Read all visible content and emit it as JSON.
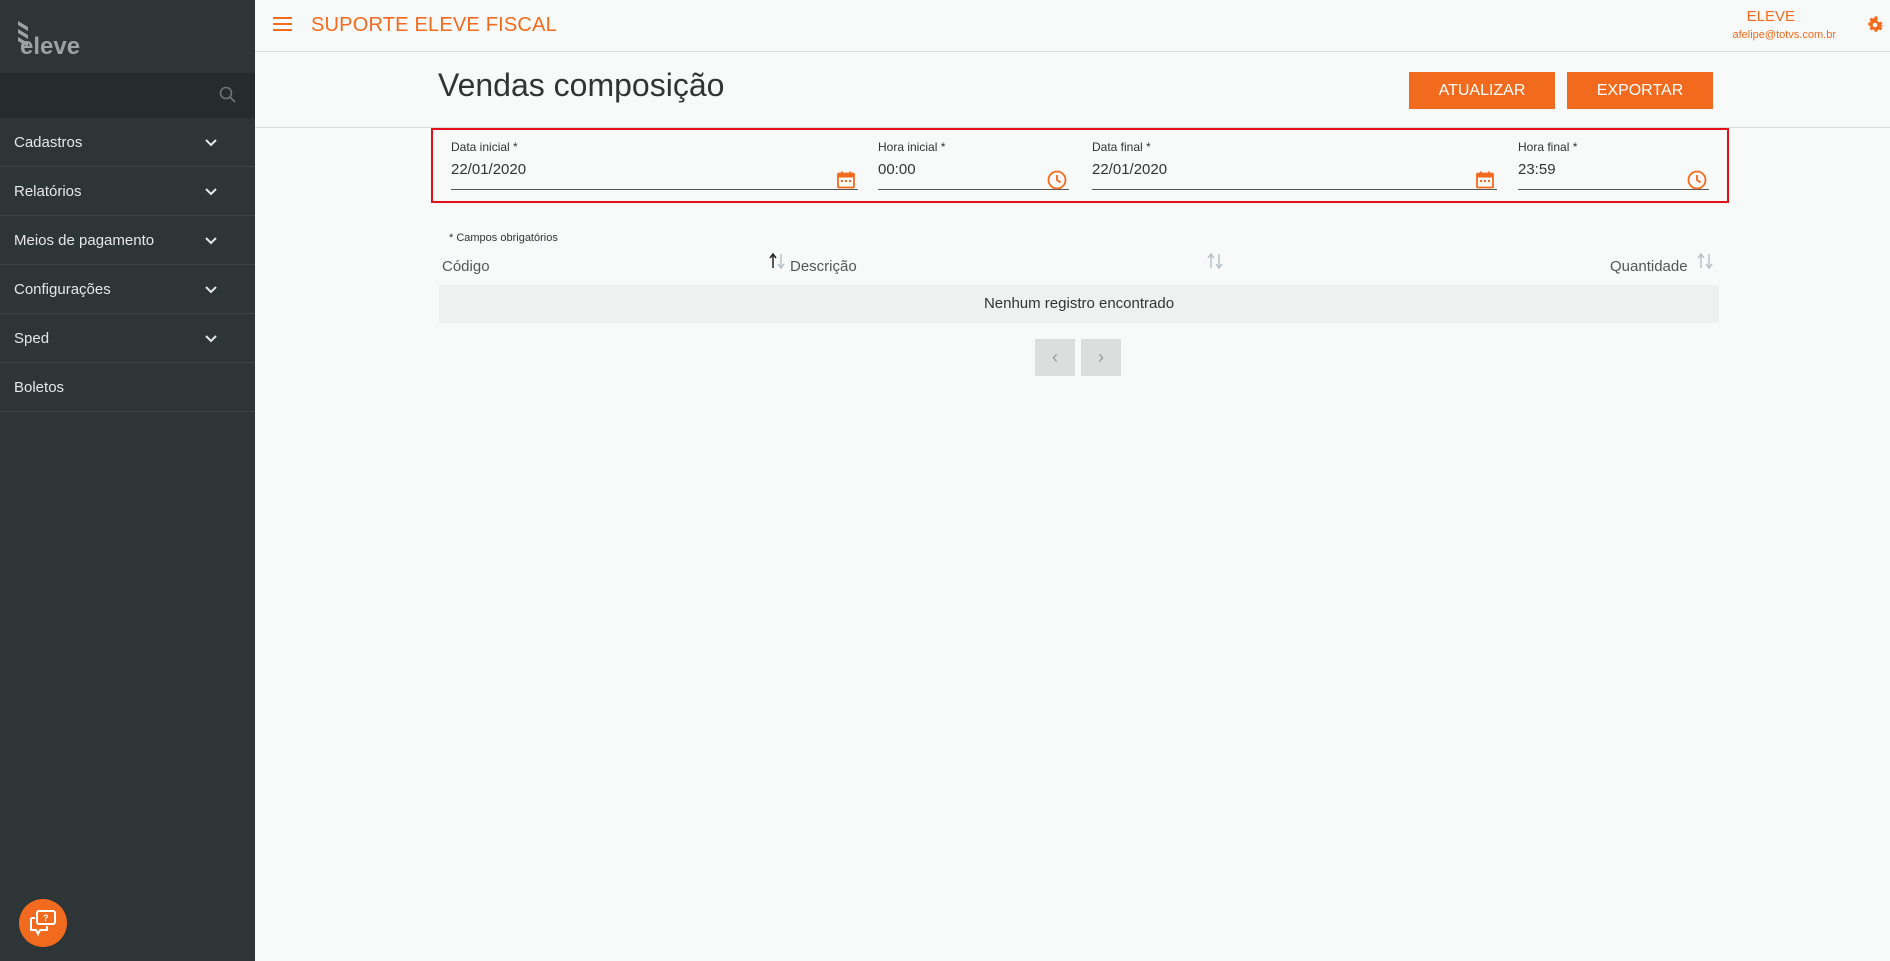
{
  "sidebar": {
    "logo_text": "eleve",
    "items": [
      {
        "label": "Cadastros",
        "expandable": true
      },
      {
        "label": "Relatórios",
        "expandable": true
      },
      {
        "label": "Meios de pagamento",
        "expandable": true
      },
      {
        "label": "Configurações",
        "expandable": true
      },
      {
        "label": "Sped",
        "expandable": true
      },
      {
        "label": "Boletos",
        "expandable": false
      }
    ]
  },
  "header": {
    "app_title": "SUPORTE ELEVE FISCAL",
    "user_name": "ELEVE",
    "user_email": "afelipe@totvs.com.br"
  },
  "page": {
    "title": "Vendas composição",
    "atualizar_label": "ATUALIZAR",
    "exportar_label": "EXPORTAR"
  },
  "filters": {
    "data_inicial": {
      "label": "Data inicial *",
      "value": "22/01/2020"
    },
    "hora_inicial": {
      "label": "Hora inicial *",
      "value": "00:00"
    },
    "data_final": {
      "label": "Data final *",
      "value": "22/01/2020"
    },
    "hora_final": {
      "label": "Hora final *",
      "value": "23:59"
    },
    "required_note": "* Campos obrigatórios"
  },
  "table": {
    "columns": [
      "Código",
      "Descrição",
      "Quantidade"
    ],
    "empty_message": "Nenhum registro encontrado"
  },
  "pager": {
    "prev": "‹",
    "next": "›"
  },
  "colors": {
    "accent": "#f26a1d",
    "sidebar": "#2d3537",
    "highlight": "#e2101a"
  }
}
